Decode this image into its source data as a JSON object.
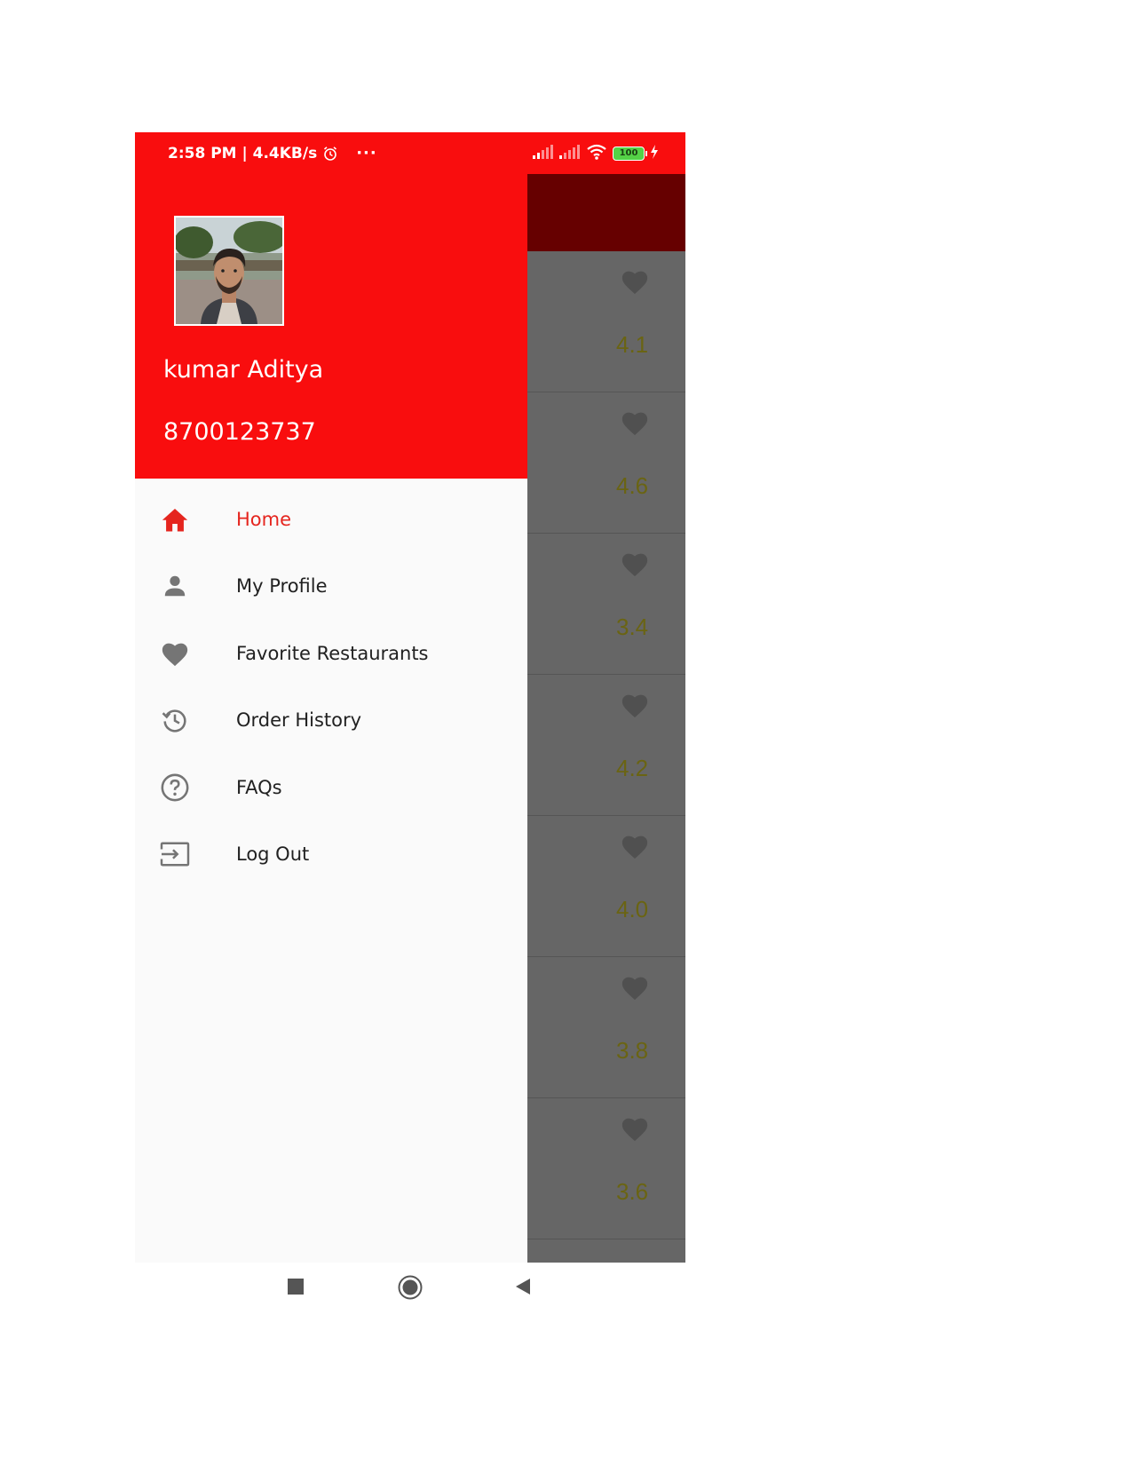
{
  "status_bar": {
    "time_speed": "2:58 PM | 4.4KB/s",
    "more": "···",
    "battery_level": "100"
  },
  "drawer": {
    "user_name": "kumar Aditya",
    "user_phone": "8700123737",
    "menu_items": [
      {
        "label": "Home",
        "icon": "home-icon",
        "active": true
      },
      {
        "label": "My Profile",
        "icon": "person-icon",
        "active": false
      },
      {
        "label": "Favorite Restaurants",
        "icon": "heart-icon",
        "active": false
      },
      {
        "label": "Order History",
        "icon": "history-icon",
        "active": false
      },
      {
        "label": "FAQs",
        "icon": "help-icon",
        "active": false
      },
      {
        "label": "Log Out",
        "icon": "logout-icon",
        "active": false
      }
    ]
  },
  "background_list": {
    "ratings": [
      "4.1",
      "4.6",
      "3.4",
      "4.2",
      "4.0",
      "3.8",
      "3.6"
    ]
  },
  "colors": {
    "header_red": "#f90d0e",
    "active_red": "#e5251e",
    "toolbar_dim": "#660000",
    "overlay_gray": "#666666"
  }
}
